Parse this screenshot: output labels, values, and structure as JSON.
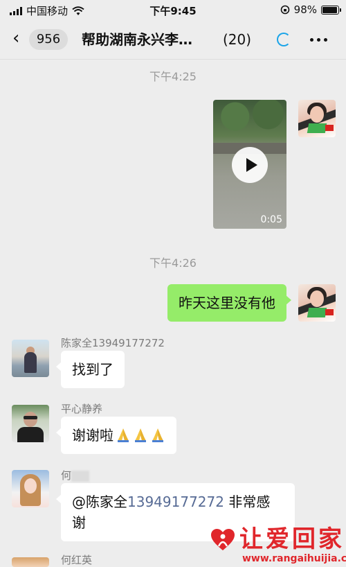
{
  "status_bar": {
    "carrier": "中国移动",
    "time": "下午9:45",
    "battery": "98%"
  },
  "nav": {
    "back_count": "956",
    "title": "帮助湖南永兴李…",
    "member_count": "(20)"
  },
  "messages": {
    "timestamp_1": "下午4:25",
    "video_duration": "0:05",
    "timestamp_2": "下午4:26",
    "self_text": "昨天这里没有他",
    "chen_name": "陈家全13949177272",
    "chen_text": "找到了",
    "ping_name": "平心静养",
    "ping_text": "谢谢啦",
    "he_name": "何",
    "he_text_prefix": "@陈家全",
    "he_text_number": "13949177272",
    "he_text_suffix": " 非常感谢",
    "he2_name": "何红英"
  },
  "watermark": {
    "title": "让爱回家",
    "url": "www.rangaihuijia.com"
  },
  "colors": {
    "outgoing_bubble": "#95ec69",
    "mention_link": "#576b95",
    "loader": "#1aa4e8",
    "watermark": "#e0262b"
  }
}
